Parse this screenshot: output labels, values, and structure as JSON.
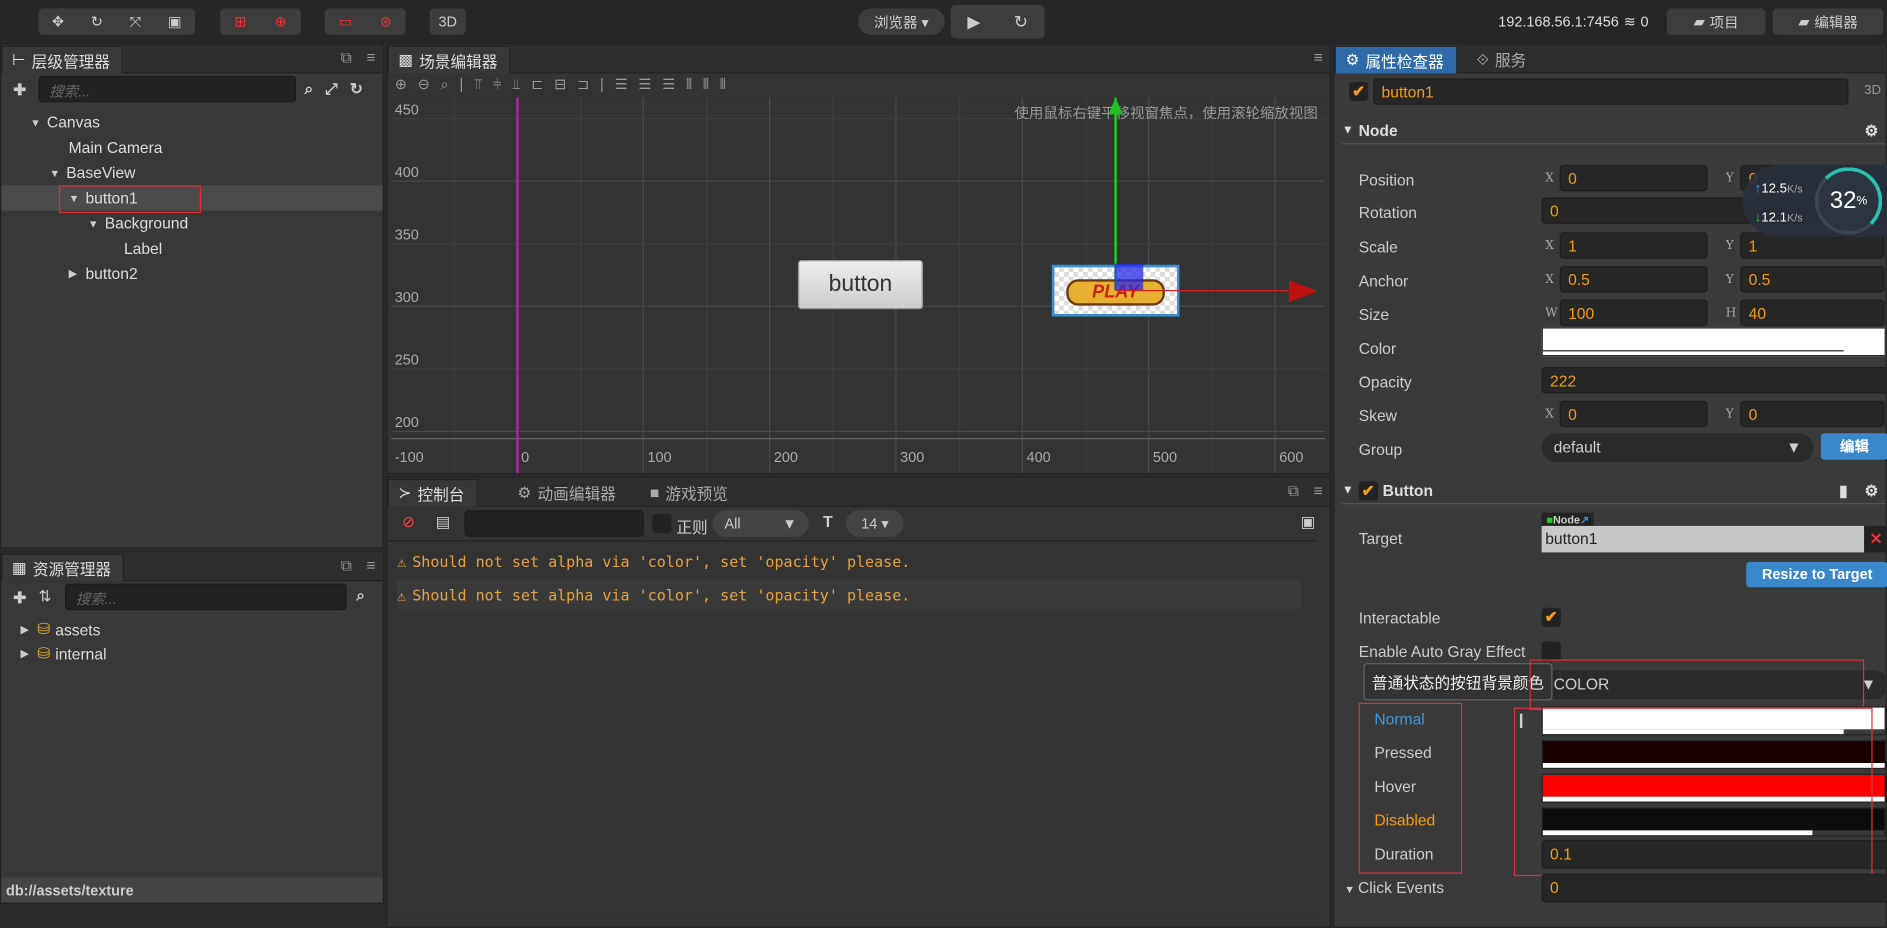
{
  "toolbar": {
    "tools": [
      "move-icon",
      "rotate-icon",
      "scale-icon",
      "rect-icon"
    ],
    "anchor_tools": [
      "pivot-icon",
      "center-icon"
    ],
    "coord_tools": [
      "local-icon",
      "global-icon"
    ],
    "mode_3d": "3D",
    "browser_label": "浏览器 ▾",
    "ip": "192.168.56.1:7456",
    "connections": "0",
    "project_label": "项目",
    "editor_label": "编辑器"
  },
  "hierarchy": {
    "title": "层级管理器",
    "search_placeholder": "搜索...",
    "nodes": [
      {
        "label": "Canvas",
        "expanded": true
      },
      {
        "label": "Main Camera"
      },
      {
        "label": "BaseView",
        "expanded": true
      },
      {
        "label": "button1",
        "expanded": true,
        "selected": true
      },
      {
        "label": "Background",
        "expanded": true
      },
      {
        "label": "Label"
      },
      {
        "label": "button2",
        "expanded": false
      }
    ]
  },
  "assets": {
    "title": "资源管理器",
    "search_placeholder": "搜索...",
    "items": [
      "assets",
      "internal"
    ],
    "status_path": "db://assets/texture"
  },
  "scene": {
    "title": "场景编辑器",
    "hint": "使用鼠标右键平移视窗焦点，使用滚轮缩放视图",
    "x_ticks": [
      "-100",
      "0",
      "100",
      "200",
      "300",
      "400",
      "500",
      "600"
    ],
    "y_ticks": [
      "450",
      "400",
      "350",
      "300",
      "250",
      "200"
    ],
    "button_text": "button",
    "sprite_text": "PLAY"
  },
  "console": {
    "tabs": [
      "控制台",
      "动画编辑器",
      "游戏预览"
    ],
    "regex_label": "正则",
    "level": "All",
    "font_size": "14 ▾",
    "messages": [
      "Should not set alpha via 'color', set 'opacity' please.",
      "Should not set alpha via 'color', set 'opacity' please."
    ]
  },
  "inspector": {
    "tabs": [
      "属性检查器",
      "服务"
    ],
    "node_name": "button1",
    "mode": "3D",
    "node_section": "Node",
    "props": {
      "position": {
        "label": "Position",
        "x": "0",
        "y": "0"
      },
      "rotation": {
        "label": "Rotation",
        "value": "0"
      },
      "scale": {
        "label": "Scale",
        "x": "1",
        "y": "1"
      },
      "anchor": {
        "label": "Anchor",
        "x": "0.5",
        "y": "0.5"
      },
      "size": {
        "label": "Size",
        "w": "100",
        "h": "40"
      },
      "color": {
        "label": "Color",
        "value": "#FFFFFF"
      },
      "opacity": {
        "label": "Opacity",
        "value": "222"
      },
      "skew": {
        "label": "Skew",
        "x": "0",
        "y": "0"
      },
      "group": {
        "label": "Group",
        "value": "default",
        "edit": "编辑"
      }
    },
    "button_section": "Button",
    "button": {
      "target_label": "Target",
      "target_type": "Node",
      "target_value": "button1",
      "resize": "Resize to Target",
      "interactable": "Interactable",
      "auto_gray": "Enable Auto Gray Effect",
      "tooltip": "普通状态的按钮背景颜色",
      "transition": "COLOR",
      "normal": "Normal",
      "pressed": "Pressed",
      "hover": "Hover",
      "disabled": "Disabled",
      "duration": "Duration",
      "duration_value": "0.1",
      "click_events": "Click Events",
      "click_events_value": "0"
    },
    "colors": {
      "normal": "#ffffff",
      "pressed": "#1a0000",
      "hover": "#ff0000",
      "disabled": "#0d0d0d"
    }
  },
  "network": {
    "up": "12.5",
    "down": "12.1",
    "unit": "K/s",
    "cpu": "32",
    "pct": "%"
  },
  "labels": {
    "x": "X",
    "y": "Y",
    "w": "W",
    "h": "H"
  }
}
